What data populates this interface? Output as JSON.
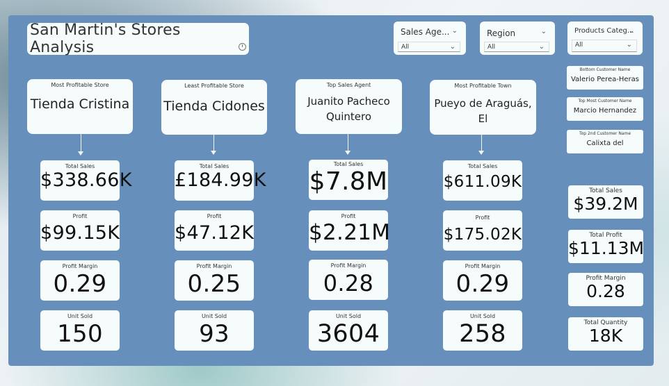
{
  "title": "San Martin's Stores Analysis",
  "slicers": [
    {
      "label": "Sales Age...",
      "value": "All"
    },
    {
      "label": "Region",
      "value": "All"
    },
    {
      "label": "Products Categ...",
      "value": "All"
    }
  ],
  "columns": [
    {
      "caption": "Most Profitable Store",
      "name": "Tienda Cristina",
      "total_sales_caption": "Total Sales",
      "total_sales": "$338.66K",
      "profit_caption": "Profit",
      "profit": "$99.15K",
      "margin_caption": "Profit Margin",
      "margin": "0.29",
      "units_caption": "Unit Sold",
      "units": "150"
    },
    {
      "caption": "Least Profitable Store",
      "name": "Tienda Cidones",
      "total_sales_caption": "Total Sales",
      "total_sales": "£184.99K",
      "profit_caption": "Profit",
      "profit": "$47.12K",
      "margin_caption": "Profit Margin",
      "margin": "0.25",
      "units_caption": "Unit Sold",
      "units": "93"
    },
    {
      "caption": "Top Sales Agent",
      "name_line1": "Juanito Pacheco",
      "name_line2": "Quintero",
      "total_sales_caption": "Total Sales",
      "total_sales": "$7.8M",
      "profit_caption": "Profit",
      "profit": "$2.21M",
      "margin_caption": "Profit Margin",
      "margin": "0.28",
      "units_caption": "Unit Sold",
      "units": "3604"
    },
    {
      "caption": "Most Profitable Town",
      "name_line1": "Pueyo de Araguás,",
      "name_line2": "El",
      "total_sales_caption": "Total Sales",
      "total_sales": "$611.09K",
      "profit_caption": "Profit",
      "profit": "$175.02K",
      "margin_caption": "Profit Margin",
      "margin": "0.29",
      "units_caption": "Unit Sold",
      "units": "258"
    }
  ],
  "customers": [
    {
      "caption": "Bottom Customer Name",
      "value": "Valerio Perea-Heras"
    },
    {
      "caption": "Top Most Customer Name",
      "value": "Marcio Hernandez"
    },
    {
      "caption": "Top 2nd Customer Name",
      "value": "Calixta del"
    }
  ],
  "summary": [
    {
      "caption": "Total Sales",
      "value": "$39.2M"
    },
    {
      "caption": "Total Profit",
      "value": "$11.13M"
    },
    {
      "caption": "Profit Margin",
      "value": "0.28"
    },
    {
      "caption": "Total Quantity",
      "value": "18K"
    }
  ]
}
